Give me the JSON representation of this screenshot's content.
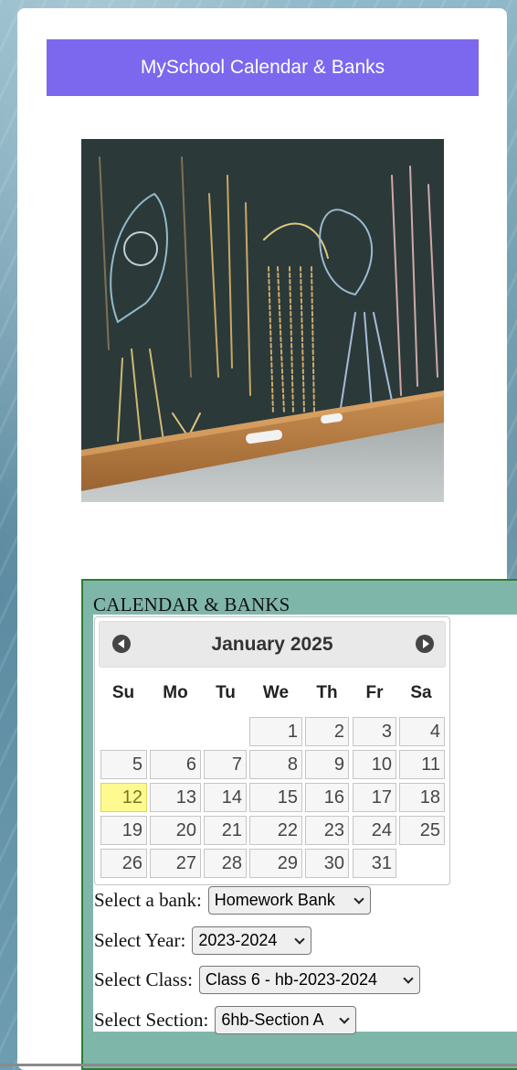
{
  "header": {
    "title": "MySchool Calendar & Banks"
  },
  "hero": {
    "alt": "chalkboard-image"
  },
  "calendar_panel": {
    "title": "CALENDAR & BANKS",
    "month_label": "January 2025",
    "days_of_week": [
      "Su",
      "Mo",
      "Tu",
      "We",
      "Th",
      "Fr",
      "Sa"
    ],
    "weeks": [
      [
        "",
        "",
        "",
        "1",
        "2",
        "3",
        "4"
      ],
      [
        "5",
        "6",
        "7",
        "8",
        "9",
        "10",
        "11"
      ],
      [
        "12",
        "13",
        "14",
        "15",
        "16",
        "17",
        "18"
      ],
      [
        "19",
        "20",
        "21",
        "22",
        "23",
        "24",
        "25"
      ],
      [
        "26",
        "27",
        "28",
        "29",
        "30",
        "31",
        ""
      ]
    ],
    "today": "12"
  },
  "form": {
    "bank_label": "Select a bank:",
    "bank_value": "Homework Bank",
    "year_label": "Select Year:",
    "year_value": "2023-2024",
    "class_label": "Select Class:",
    "class_value": "Class 6 - hb-2023-2024",
    "section_label": "Select Section:",
    "section_value": "6hb-Section A"
  },
  "colors": {
    "header_bg": "#7b68ee",
    "panel_bg": "#7fb6aa",
    "panel_border": "#2e7d32",
    "today_bg": "#fffa90"
  }
}
